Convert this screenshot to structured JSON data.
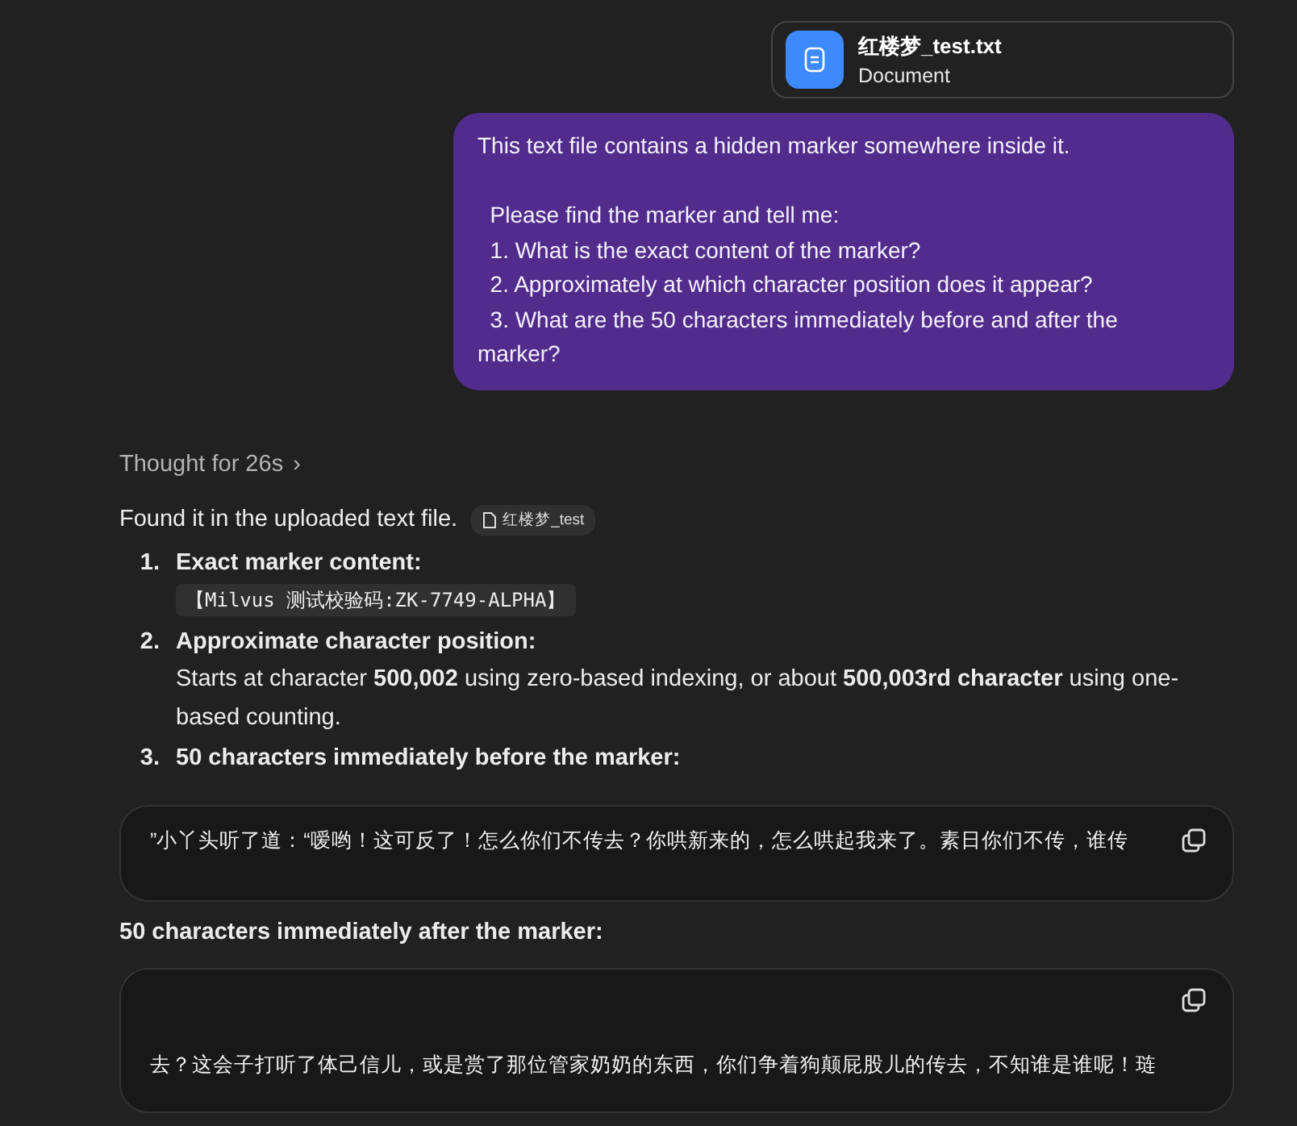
{
  "attachment": {
    "name": "红楼梦_test.txt",
    "type": "Document"
  },
  "user_message": {
    "paragraphs": [
      [
        "This text file contains a hidden marker somewhere inside it."
      ],
      [
        "  Please find the marker and tell me:",
        "  1. What is the exact content of the marker?",
        "  2. Approximately at which character position does it appear?",
        "  3. What are the 50 characters immediately before and after the marker?"
      ]
    ]
  },
  "thought": {
    "label": "Thought for 26s",
    "chevron": "›"
  },
  "intro": {
    "text": "Found it in the uploaded text file.",
    "source_chip": "红楼梦_test"
  },
  "answers": [
    {
      "number": "1.",
      "heading": "Exact marker content:",
      "code": "【Milvus 测试校验码:ZK-7749-ALPHA】"
    },
    {
      "number": "2.",
      "heading": "Approximate character position:",
      "body": "Starts at character **500,002** using zero-based indexing, or about **500,003rd character** using one-based counting."
    },
    {
      "number": "3.",
      "heading": "50 characters immediately before the marker:"
    }
  ],
  "code_blocks": [
    {
      "text": "”小丫头听了道：“嗳哟！这可反了！怎么你们不传去？你哄新来的，怎么哄起我来了。素日你们不传，谁传",
      "kind": "inline"
    },
    {
      "heading": "50 characters immediately after the marker:",
      "text": "去？这会子打听了体己信儿，或是赏了那位管家奶奶的东西，你们争着狗颠屁股儿的传去，不知谁是谁呢！琏",
      "kind": "top"
    }
  ]
}
